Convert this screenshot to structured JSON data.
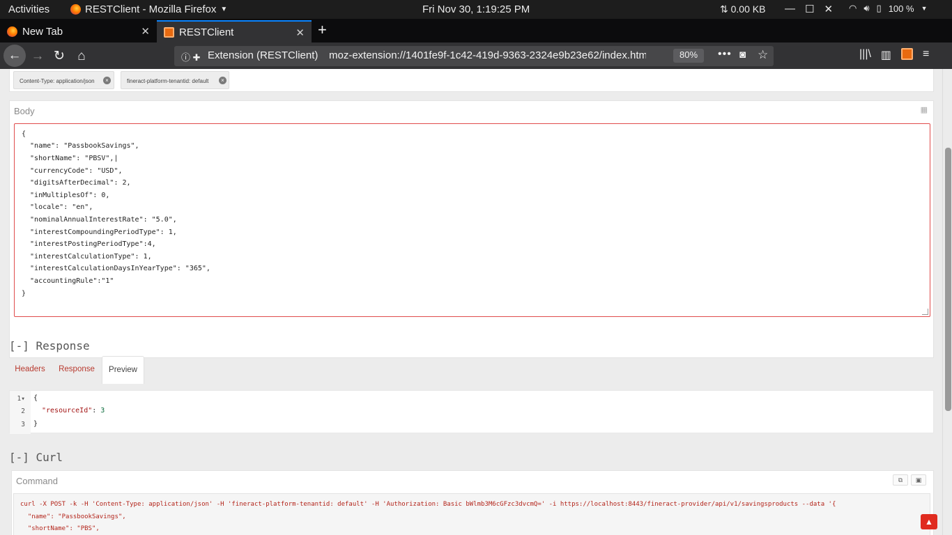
{
  "system_bar": {
    "activities": "Activities",
    "app_title": "RESTClient - Mozilla Firefox",
    "clock": "Fri Nov 30,  1:19:25 PM",
    "net_speed": "0.00 KB",
    "battery": "100 %"
  },
  "tabs": [
    {
      "label": "New Tab"
    },
    {
      "label": "RESTClient"
    }
  ],
  "urlbar": {
    "identity": "Extension (RESTClient)",
    "url": "moz-extension://1401fe9f-1c42-419d-9363-2324e9b23e62/index.html",
    "zoom": "80%"
  },
  "headers": {
    "chips": [
      {
        "label": "Content-Type: application/json"
      },
      {
        "label": "fineract-platform-tenantid: default"
      }
    ]
  },
  "body": {
    "title": "Body",
    "lines": [
      "{",
      "  \"name\": \"PassbookSavings\",",
      "  \"shortName\": \"PBSV\",|",
      "  \"currencyCode\": \"USD\",",
      "  \"digitsAfterDecimal\": 2,",
      "  \"inMultiplesOf\": 0,",
      "  \"locale\": \"en\",",
      "  \"nominalAnnualInterestRate\": \"5.0\",",
      "  \"interestCompoundingPeriodType\": 1,",
      "  \"interestPostingPeriodType\":4,",
      "  \"interestCalculationType\": 1,",
      "  \"interestCalculationDaysInYearType\": \"365\",",
      "  \"accountingRule\":\"1\"",
      "}"
    ]
  },
  "response": {
    "title": "[-] Response",
    "tabs": [
      "Headers",
      "Response",
      "Preview"
    ],
    "active_tab": "Preview",
    "gutter": [
      "1▾",
      "2",
      "3"
    ],
    "preview": {
      "open": "{",
      "key": "\"resourceId\"",
      "colon": ": ",
      "value": "3",
      "close": "}"
    }
  },
  "curl": {
    "title": "[-] Curl",
    "command_label": "Command",
    "lines": [
      "curl -X POST -k -H 'Content-Type: application/json' -H 'fineract-platform-tenantid: default' -H 'Authorization: Basic bWlmb3M6cGFzc3dvcmQ=' -i https://localhost:8443/fineract-provider/api/v1/savingsproducts --data '{",
      "  \"name\": \"PassbookSavings\",",
      "  \"shortName\": \"PBS\","
    ]
  }
}
